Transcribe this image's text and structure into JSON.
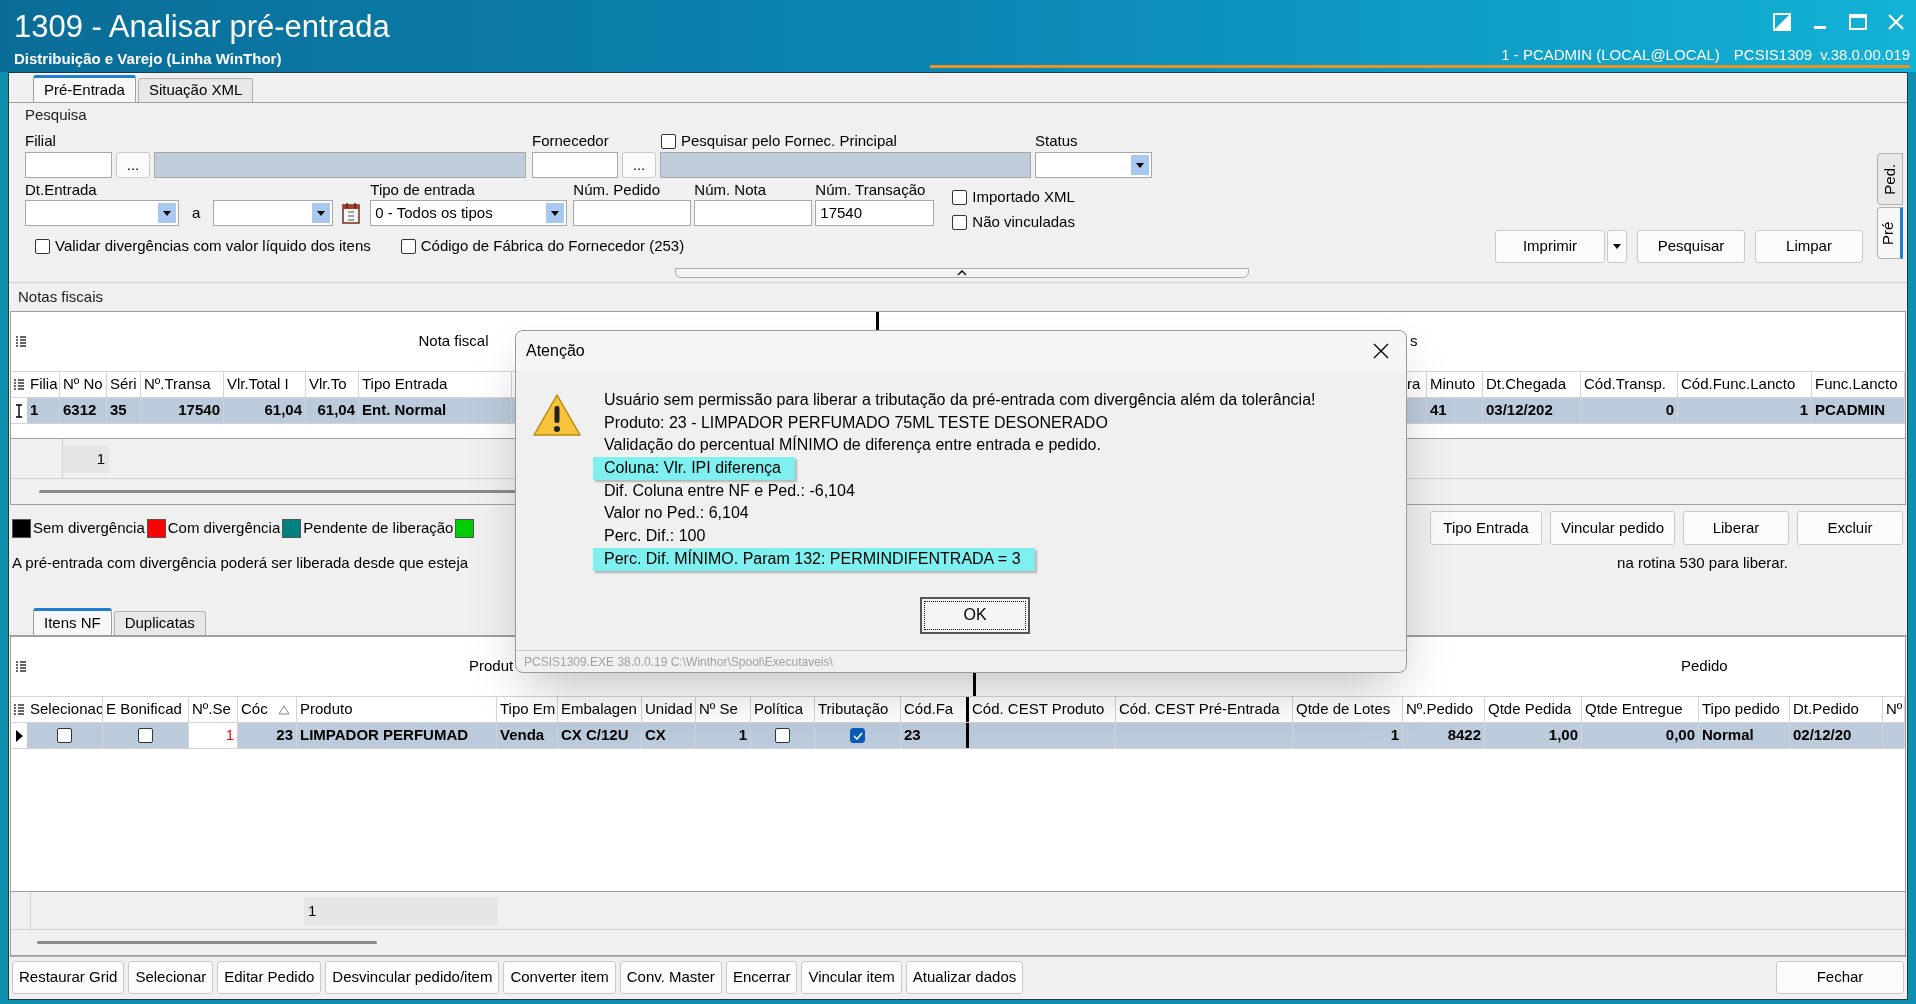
{
  "window": {
    "title": "1309 - Analisar pré-entrada",
    "subtitle": "Distribuição e Varejo (Linha WinThor)",
    "session": "1 - PCADMIN (LOCAL@LOCAL)",
    "program": "PCSIS1309",
    "version": "v.38.0.00.019"
  },
  "tabs": [
    {
      "label": "Pré-Entrada",
      "selected": true
    },
    {
      "label": "Situação XML",
      "selected": false
    }
  ],
  "side_tabs": [
    {
      "label": "Ped.",
      "selected": false
    },
    {
      "label": "Pré",
      "selected": true
    }
  ],
  "search": {
    "title": "Pesquisa",
    "filial": {
      "label": "Filial",
      "browse": "..."
    },
    "fornecedor": {
      "label": "Fornecedor",
      "browse": "..."
    },
    "principal": {
      "label": "Pesquisar pelo Fornec. Principal",
      "checked": false
    },
    "status": {
      "label": "Status"
    },
    "dt_entrada": {
      "label": "Dt.Entrada",
      "separator": "a"
    },
    "tipo": {
      "label": "Tipo de entrada",
      "value": "0 - Todos os tipos"
    },
    "num_pedido": {
      "label": "Núm. Pedido"
    },
    "num_nota": {
      "label": "Núm. Nota"
    },
    "num_transacao": {
      "label": "Núm. Transação",
      "value": "17540"
    },
    "options": [
      {
        "label": "Importado XML",
        "checked": false
      },
      {
        "label": "Não vinculadas",
        "checked": false
      }
    ],
    "checks": [
      {
        "label": "Validar divergências com valor líquido dos itens",
        "checked": false
      },
      {
        "label": "Código de Fábrica do Fornecedor (253)",
        "checked": false
      }
    ],
    "buttons": [
      "Imprimir",
      "Pesquisar",
      "Limpar"
    ]
  },
  "notas": {
    "title": "Notas fiscais",
    "bands": [
      "Nota fiscal",
      "s"
    ],
    "columns": [
      "Filia",
      "Nº No",
      "Séri",
      "Nº.Transa",
      "Vlr.Total I",
      "Vlr.To",
      "Tipo Entrada",
      "ra",
      "Minuto",
      "Dt.Chegada",
      "Cód.Transp.",
      "Cód.Func.Lancto",
      "Func.Lancto"
    ],
    "rows": [
      {
        "selected": true,
        "cells": [
          {
            "kind": "text",
            "value": "1"
          },
          {
            "kind": "text",
            "value": "6312"
          },
          {
            "kind": "text",
            "value": "35"
          },
          {
            "kind": "number",
            "value": "17540"
          },
          {
            "kind": "number",
            "value": "61,04"
          },
          {
            "kind": "number",
            "value": "61,04"
          },
          {
            "kind": "text",
            "value": "Ent. Normal"
          },
          {
            "kind": "empty"
          },
          {
            "kind": "text",
            "value": "41"
          },
          {
            "kind": "text",
            "value": "03/12/202"
          },
          {
            "kind": "number",
            "value": "0"
          },
          {
            "kind": "number",
            "value": "1"
          },
          {
            "kind": "text",
            "value": "PCADMIN"
          }
        ]
      }
    ],
    "footer": "1"
  },
  "legend": [
    {
      "label": "Sem divergência",
      "color": "#000000"
    },
    {
      "label": "Com divergência",
      "color": "#ff0000"
    },
    {
      "label": "Pendente de liberação",
      "color": "#008080"
    },
    {
      "color": "#00cc00"
    }
  ],
  "note_left": "A pré-entrada com divergência poderá ser liberada desde que esteja",
  "note_right": "na rotina 530 para liberar.",
  "actions": [
    "Tipo Entrada",
    "Vincular pedido",
    "Liberar",
    "Excluir"
  ],
  "item_tabs": [
    {
      "label": "Itens NF",
      "selected": true
    },
    {
      "label": "Duplicatas",
      "selected": false
    }
  ],
  "itens": {
    "bands": [
      "Produt",
      "Pedido"
    ],
    "columns": [
      {
        "label": "Selecionac"
      },
      {
        "label": "E Bonificad"
      },
      {
        "label": "Nº.Se"
      },
      {
        "label": "Cóc",
        "sorted": true
      },
      {
        "label": "Produto"
      },
      {
        "label": "Tipo Em"
      },
      {
        "label": "Embalagen"
      },
      {
        "label": "Unidad"
      },
      {
        "label": "Nº Se"
      },
      {
        "label": "Política"
      },
      {
        "label": "Tributação"
      },
      {
        "label": "Cód.Fa"
      },
      {
        "label": "Cód. CEST Produto"
      },
      {
        "label": "Cód. CEST Pré-Entrada"
      },
      {
        "label": "Qtde de Lotes"
      },
      {
        "label": "Nº.Pedido"
      },
      {
        "label": "Qtde Pedida"
      },
      {
        "label": "Qtde Entregue"
      },
      {
        "label": "Tipo pedido"
      },
      {
        "label": "Dt.Pedido"
      },
      {
        "label": "Nº"
      }
    ],
    "rows": [
      {
        "selected": true,
        "cells": [
          {
            "kind": "checkbox",
            "checked": false
          },
          {
            "kind": "checkbox",
            "checked": false
          },
          {
            "kind": "number",
            "value": "1",
            "color": "#ff0000"
          },
          {
            "kind": "number",
            "value": "23"
          },
          {
            "kind": "text",
            "value": "LIMPADOR PERFUMAD"
          },
          {
            "kind": "text",
            "value": "Venda"
          },
          {
            "kind": "text",
            "value": "CX C/12U"
          },
          {
            "kind": "text",
            "value": "CX"
          },
          {
            "kind": "number",
            "value": "1"
          },
          {
            "kind": "checkbox",
            "checked": false
          },
          {
            "kind": "checkbox",
            "checked": true
          },
          {
            "kind": "text",
            "value": "23"
          },
          {
            "kind": "empty"
          },
          {
            "kind": "empty"
          },
          {
            "kind": "number",
            "value": "1"
          },
          {
            "kind": "number",
            "value": "8422"
          },
          {
            "kind": "number",
            "value": "1,00"
          },
          {
            "kind": "number",
            "value": "0,00"
          },
          {
            "kind": "text",
            "value": "Normal"
          },
          {
            "kind": "text",
            "value": "02/12/20"
          },
          {
            "kind": "empty"
          }
        ]
      }
    ],
    "footer": "1"
  },
  "bottom_buttons": [
    "Restaurar Grid",
    "Selecionar",
    "Editar Pedido",
    "Desvincular pedido/item",
    "Converter item",
    "Conv. Master",
    "Encerrar",
    "Vincular item",
    "Atualizar dados"
  ],
  "close_button": "Fechar",
  "dialog": {
    "title": "Atenção",
    "lines": [
      {
        "kind": "text",
        "text": "Usuário sem permissão para liberar a tributação da pré-entrada com divergência além da tolerância!"
      },
      {
        "kind": "text",
        "text": "Produto: 23 - LIMPADOR PERFUMADO 75ML TESTE DESONERADO"
      },
      {
        "kind": "text",
        "text": "Validação do percentual MÍNIMO de diferença entre entrada e pedido."
      },
      {
        "kind": "highlight",
        "text": "Coluna: Vlr. IPI diferença"
      },
      {
        "kind": "text",
        "text": "Dif. Coluna entre NF e Ped.: -6,104"
      },
      {
        "kind": "text",
        "text": "Valor no Ped.: 6,104"
      },
      {
        "kind": "text",
        "text": "Perc. Dif.: 100"
      },
      {
        "kind": "highlight",
        "text": "Perc. Dif. MÍNIMO. Param 132: PERMINDIFENTRADA = 3"
      }
    ],
    "button": "OK",
    "status": "PCSIS1309.EXE 38.0.0.19 C:\\Winthor\\Spool\\Executaveis\\"
  }
}
